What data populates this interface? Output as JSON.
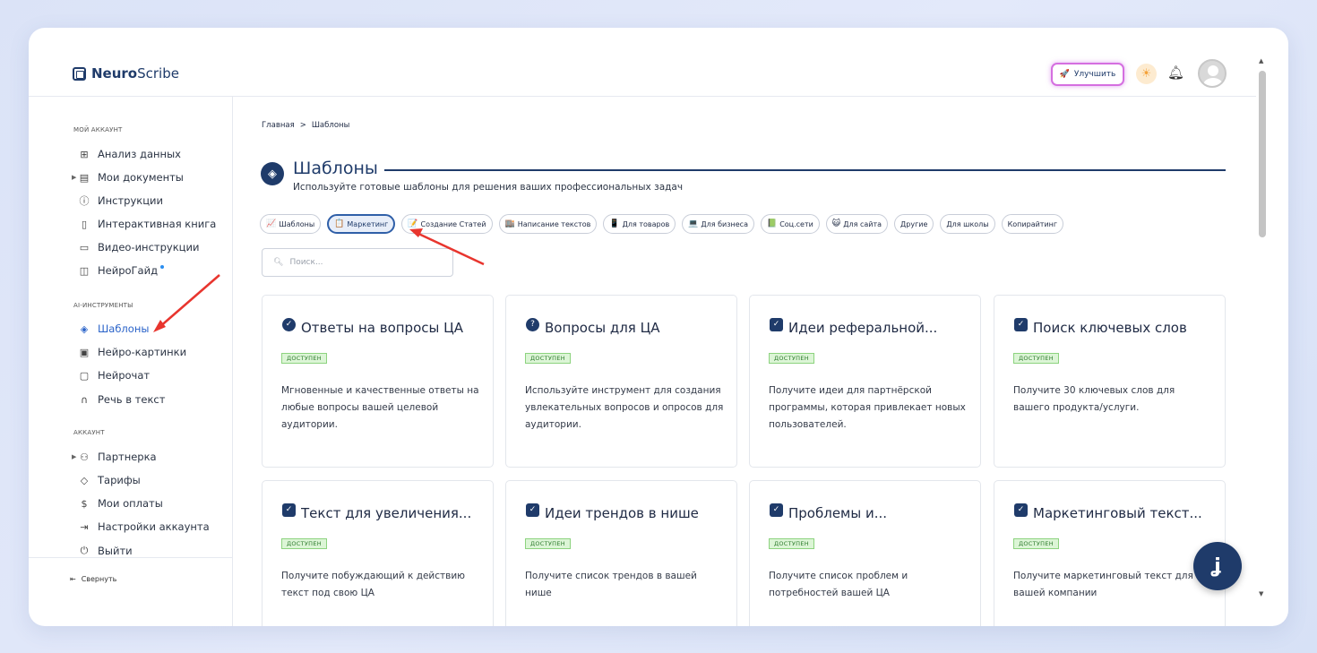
{
  "app": {
    "logo_bold": "Neuro",
    "logo_rest": "Scribe"
  },
  "header": {
    "upgrade_label": "Улучшить"
  },
  "sidebar": {
    "section_account": "МОЙ АККАУНТ",
    "items_account": [
      "Анализ данных",
      "Мои документы",
      "Инструкции",
      "Интерактивная книга",
      "Видео-инструкции",
      "НейроГайд"
    ],
    "section_ai": "AI-ИНСТРУМЕНТЫ",
    "items_ai": [
      "Шаблоны",
      "Нейро-картинки",
      "Нейрочат",
      "Речь в текст"
    ],
    "section_acc": "АККАУНТ",
    "items_acc": [
      "Партнерка",
      "Тарифы",
      "Мои оплаты",
      "Настройки аккаунта",
      "Выйти"
    ],
    "collapse_label": "Свернуть"
  },
  "breadcrumb": {
    "home": "Главная",
    "sep": ">",
    "current": "Шаблоны"
  },
  "page": {
    "title": "Шаблоны",
    "subtitle": "Используйте готовые шаблоны для решения ваших профессиональных задач"
  },
  "tabs": [
    "Шаблоны",
    "Маркетинг",
    "Создание Статей",
    "Написание текстов",
    "Для товаров",
    "Для бизнеса",
    "Соц.сети",
    "Для сайта",
    "Другие",
    "Для школы",
    "Копирайтинг"
  ],
  "tab_icons": [
    "📈",
    "📋",
    "📝",
    "🏬",
    "📱",
    "💻",
    "📗",
    "😺",
    "",
    "",
    ""
  ],
  "search": {
    "placeholder": "Поиск..."
  },
  "badge_label": "ДОСТУПЕН",
  "cards": [
    {
      "title": "Ответы на вопросы ЦА",
      "desc": "Мгновенные и качественные ответы на любые вопросы вашей целевой аудитории."
    },
    {
      "title": "Вопросы для ЦА",
      "desc": "Используйте инструмент для создания увлекательных вопросов и опросов для аудитории."
    },
    {
      "title": "Идеи реферальной...",
      "desc": "Получите идеи для партнёрской программы, которая привлекает новых пользователей."
    },
    {
      "title": "Поиск ключевых слов",
      "desc": "Получите 30 ключевых слов для вашего продукта/услуги."
    },
    {
      "title": "Текст для увеличения...",
      "desc": "Получите побуждающий к действию текст под свою ЦА"
    },
    {
      "title": "Идеи трендов в нише",
      "desc": "Получите список трендов в вашей нише"
    },
    {
      "title": "Проблемы и...",
      "desc": "Получите список проблем и потребностей вашей ЦА"
    },
    {
      "title": "Маркетинговый текст...",
      "desc": "Получите маркетинговый текст для вашей компании"
    }
  ],
  "fab_label": "ʝ"
}
